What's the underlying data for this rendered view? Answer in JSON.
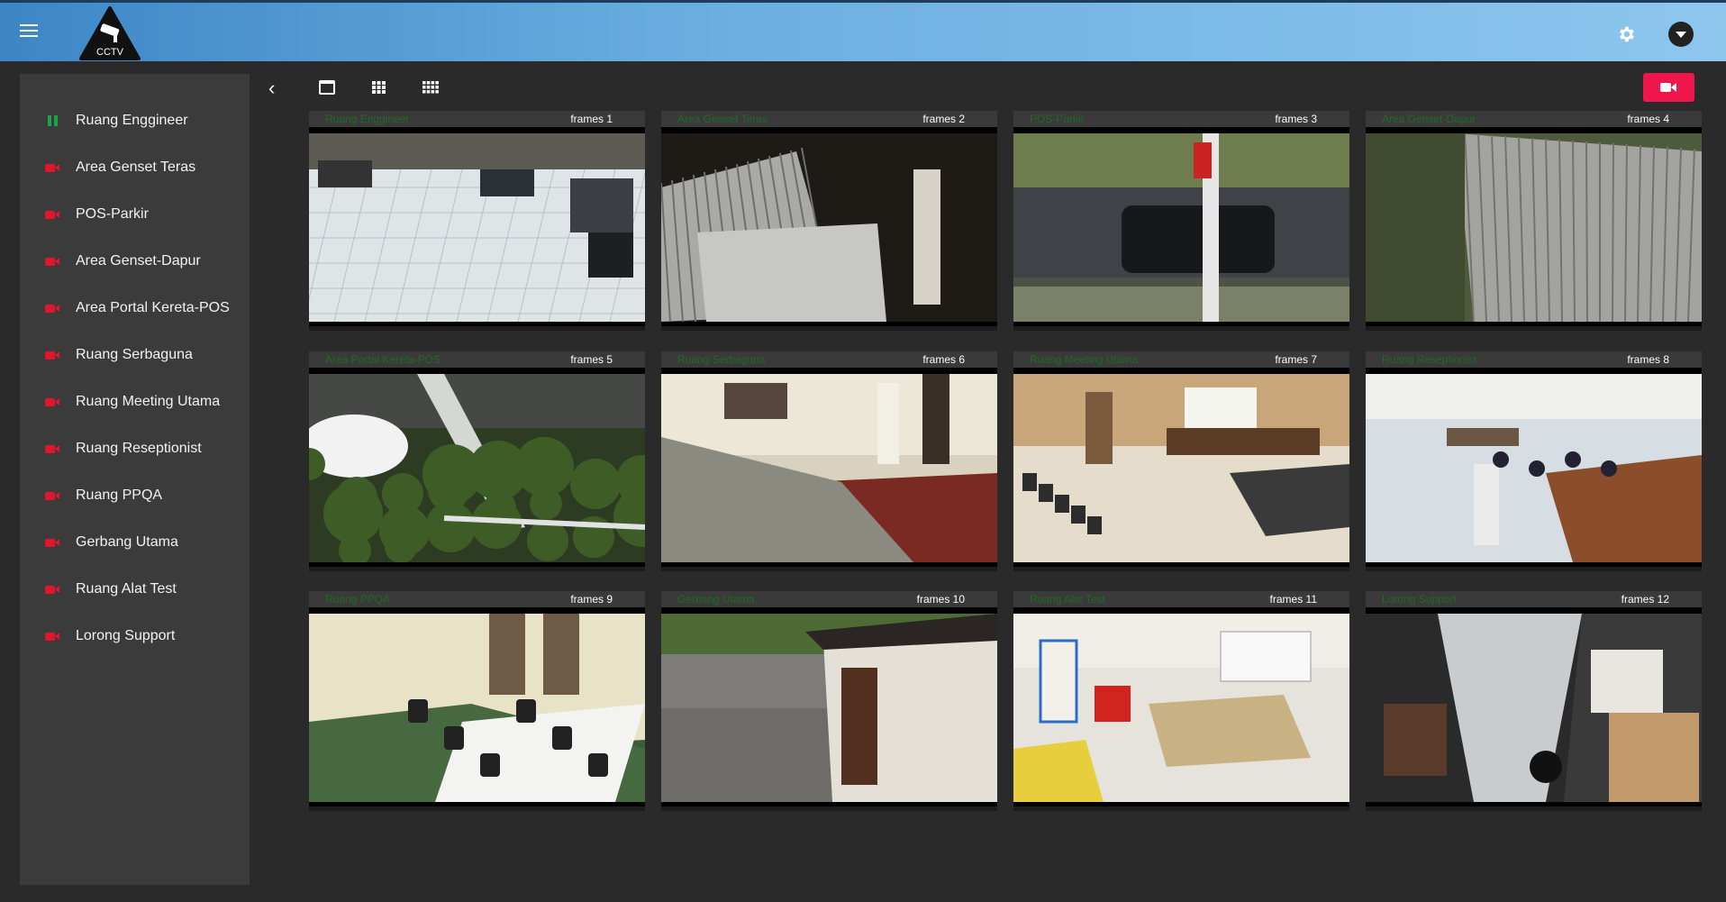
{
  "app": {
    "logo_text": "CCTV"
  },
  "sidebar": {
    "items": [
      {
        "label": "Ruang Enggineer",
        "status": "pause"
      },
      {
        "label": "Area Genset Teras",
        "status": "camera"
      },
      {
        "label": "POS-Parkir",
        "status": "camera"
      },
      {
        "label": "Area Genset-Dapur",
        "status": "camera"
      },
      {
        "label": "Area Portal Kereta-POS",
        "status": "camera"
      },
      {
        "label": "Ruang Serbaguna",
        "status": "camera"
      },
      {
        "label": "Ruang Meeting Utama",
        "status": "camera"
      },
      {
        "label": "Ruang Reseptionist",
        "status": "camera"
      },
      {
        "label": "Ruang PPQA",
        "status": "camera"
      },
      {
        "label": "Gerbang Utama",
        "status": "camera"
      },
      {
        "label": "Ruang Alat Test",
        "status": "camera"
      },
      {
        "label": "Lorong Support",
        "status": "camera"
      }
    ]
  },
  "toolbar": {
    "icons": [
      "chevron-left-icon",
      "single-view-icon",
      "grid-2x2-icon",
      "grid-3x3-icon",
      "video-camera-icon"
    ]
  },
  "tiles": [
    {
      "name": "Ruang Enggineer",
      "frames": "frames 1",
      "scene": "office"
    },
    {
      "name": "Area Genset Teras",
      "frames": "frames 2",
      "scene": "roof"
    },
    {
      "name": "POS-Parkir",
      "frames": "frames 3",
      "scene": "street"
    },
    {
      "name": "Area Genset-Dapur",
      "frames": "frames 4",
      "scene": "roof2"
    },
    {
      "name": "Area Portal Kereta-POS",
      "frames": "frames 5",
      "scene": "trees"
    },
    {
      "name": "Ruang Serbaguna",
      "frames": "frames 6",
      "scene": "hall"
    },
    {
      "name": "Ruang Meeting Utama",
      "frames": "frames 7",
      "scene": "meeting"
    },
    {
      "name": "Ruang Reseptionist",
      "frames": "frames 8",
      "scene": "reception"
    },
    {
      "name": "Ruang PPQA",
      "frames": "frames 9",
      "scene": "room"
    },
    {
      "name": "Gerbang Utama",
      "frames": "frames 10",
      "scene": "gate"
    },
    {
      "name": "Ruang Alat Test",
      "frames": "frames 11",
      "scene": "lab"
    },
    {
      "name": "Lorong Support",
      "frames": "frames 12",
      "scene": "corridor"
    }
  ],
  "colors": {
    "accent": "#f0154a",
    "camera_icon": "#e0152e",
    "pause_icon": "#16a34a",
    "camera_name": "#1f6a24"
  }
}
